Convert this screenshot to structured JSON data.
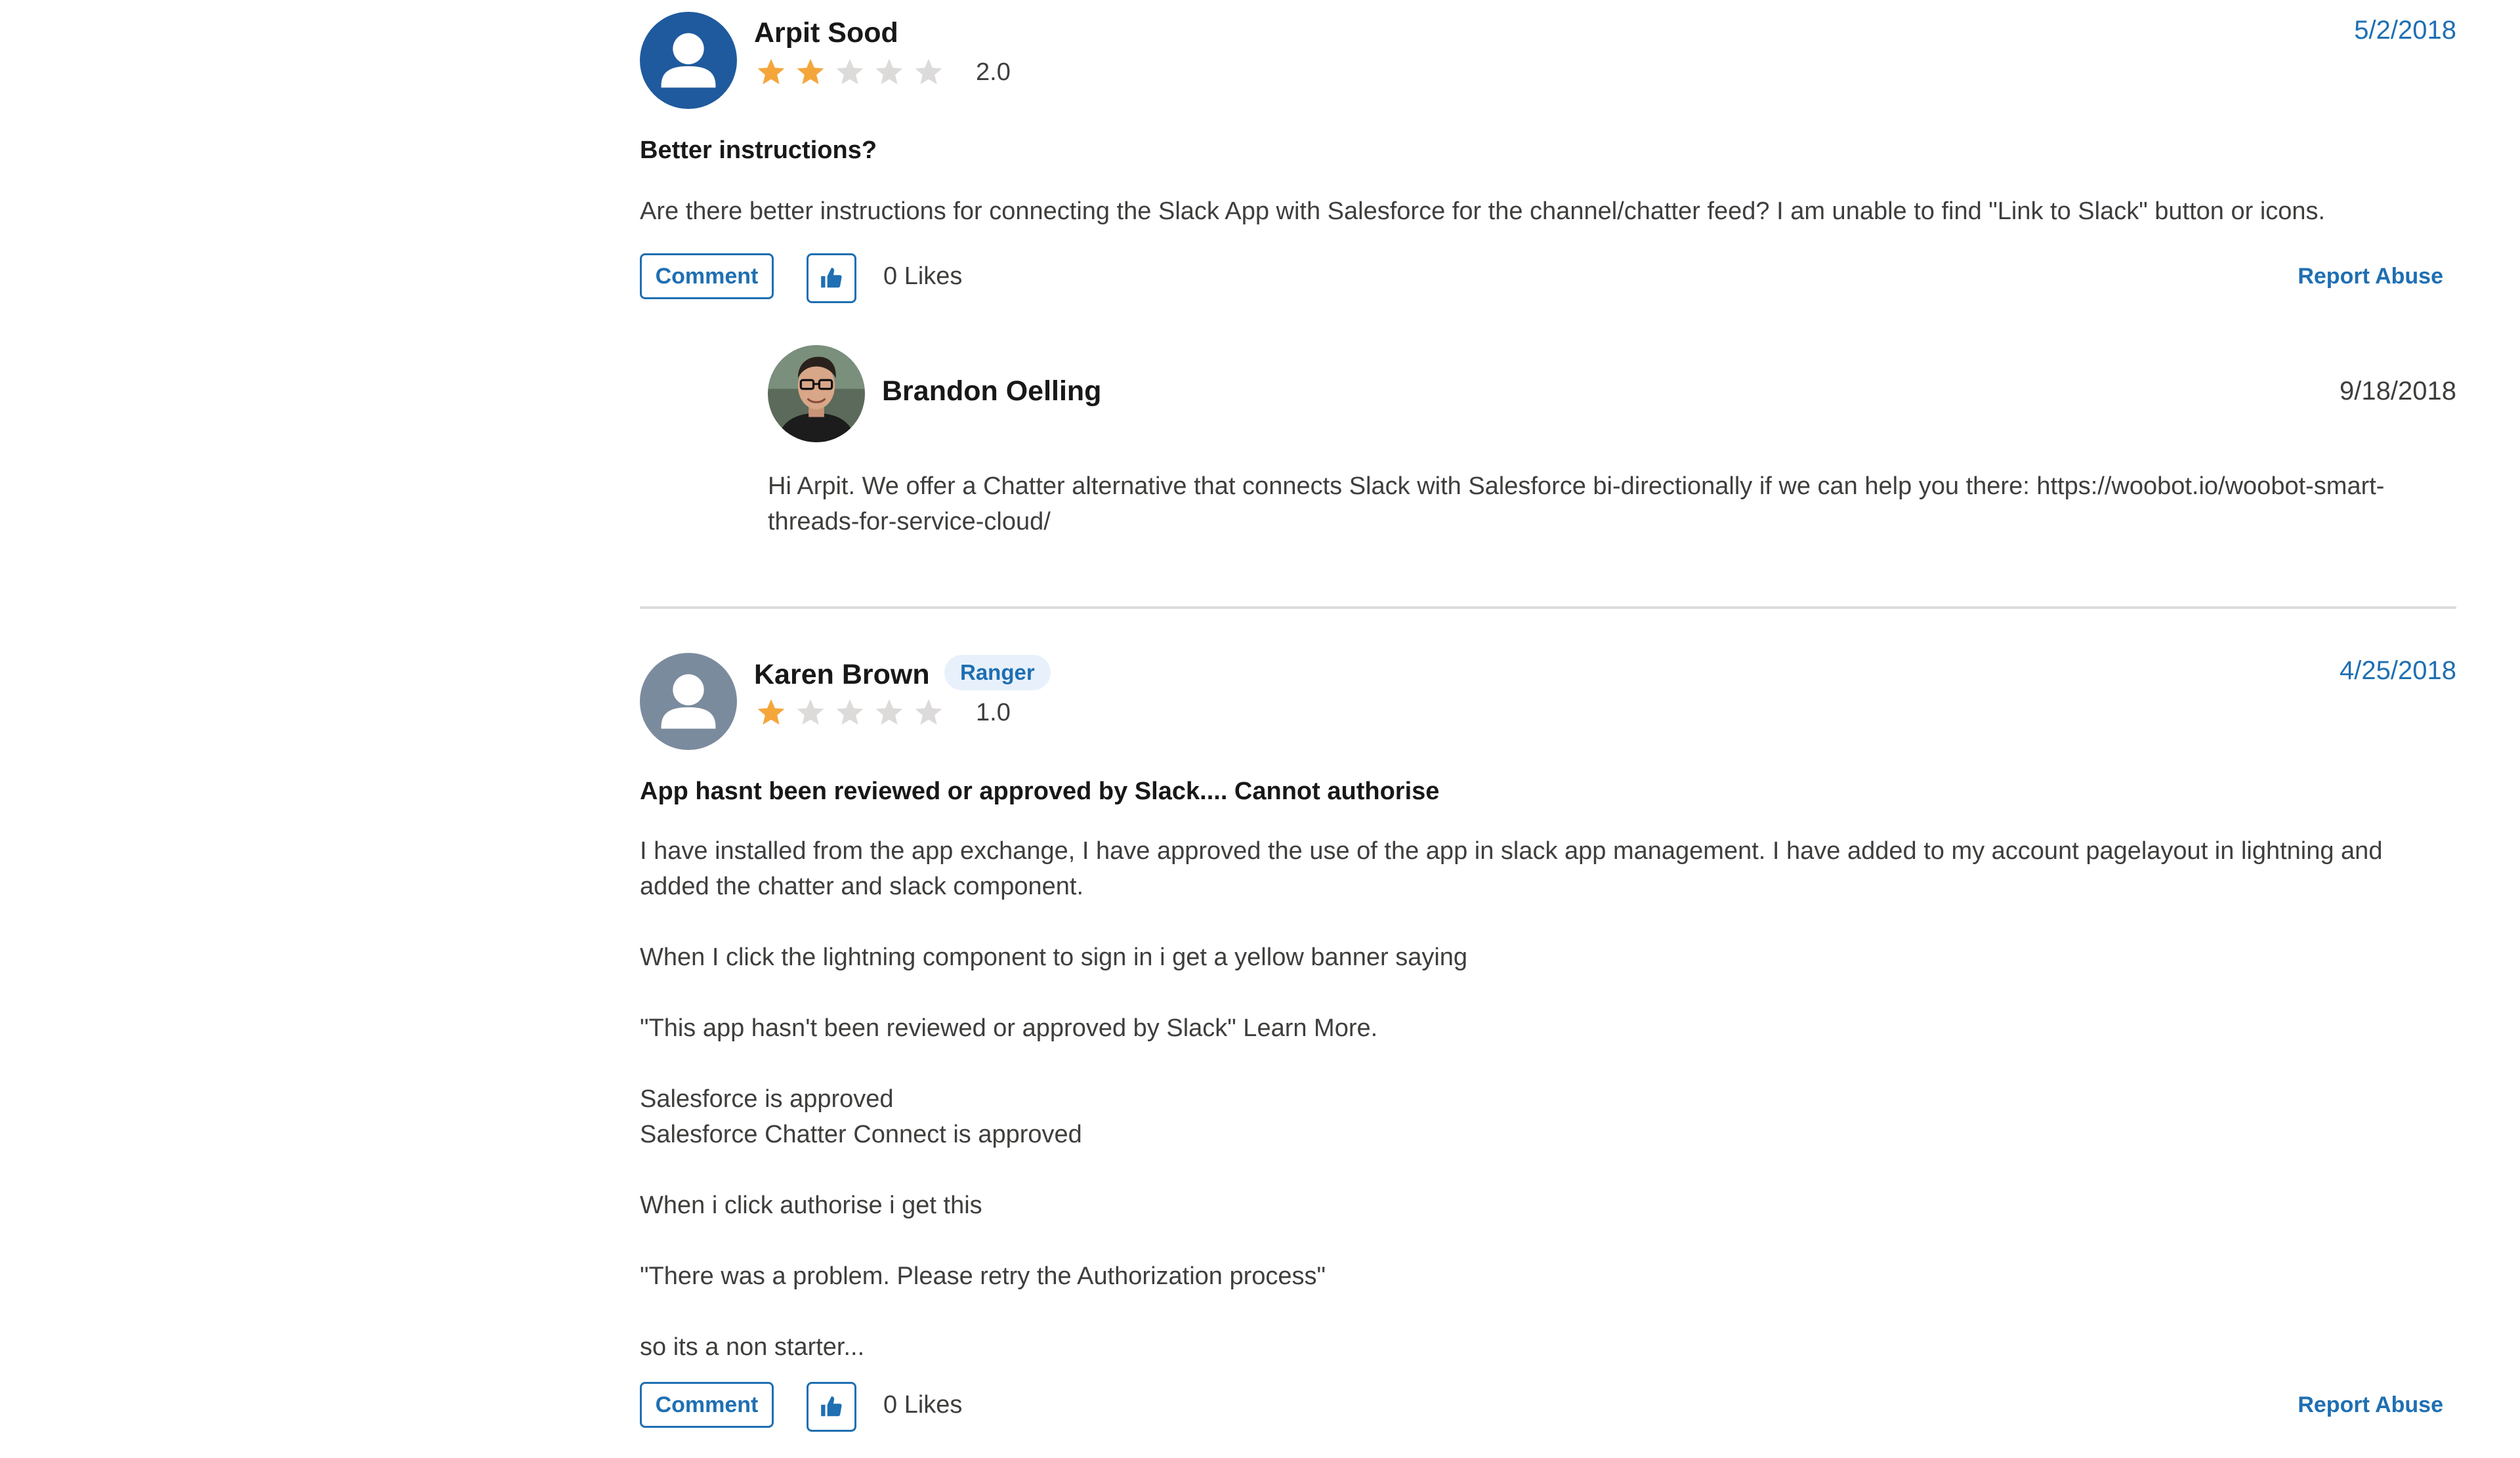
{
  "reviews": [
    {
      "author": "Arpit Sood",
      "rating_value": 2,
      "rating_text": "2.0",
      "date": "5/2/2018",
      "title": "Better instructions?",
      "body": [
        "Are there better instructions for connecting the Slack App with Salesforce for the channel/chatter feed? I am unable to find \"Link to Slack\" button or icons."
      ],
      "comment_label": "Comment",
      "likes_text": "0 Likes",
      "report_label": "Report Abuse",
      "reply": {
        "author": "Brandon Oelling",
        "date": "9/18/2018",
        "body": "Hi Arpit. We offer a Chatter alternative that connects Slack with Salesforce bi-directionally if we can help you there: https://woobot.io/woobot-smart-threads-for-service-cloud/"
      }
    },
    {
      "author": "Karen Brown",
      "badge": "Ranger",
      "rating_value": 1,
      "rating_text": "1.0",
      "date": "4/25/2018",
      "title": "App hasnt been reviewed or approved by Slack.... Cannot authorise",
      "body": [
        "I have installed from the app exchange, I have approved the use of the app in slack app management. I have added to my account pagelayout in lightning and added the chatter and slack component.",
        "When I click the lightning component to sign in i get a yellow banner saying",
        "\"This app hasn't been reviewed or approved by Slack\" Learn More.",
        "Salesforce is approved",
        "Salesforce Chatter Connect is approved",
        "When i click authorise i get this",
        "\"There was a problem. Please retry the Authorization process\"",
        "so its a non starter..."
      ],
      "comment_label": "Comment",
      "likes_text": "0 Likes",
      "report_label": "Report Abuse"
    }
  ],
  "rating_max": 5,
  "colors": {
    "star_filled": "#f4a63b",
    "star_empty": "#dddbda",
    "link_blue": "#1f6fb2",
    "avatar_blue": "#1f5a9e",
    "avatar_grey": "#7b8b9e"
  },
  "icons": {
    "avatar": "user-silhouette-icon",
    "like": "thumbs-up-icon",
    "star": "star-icon"
  }
}
